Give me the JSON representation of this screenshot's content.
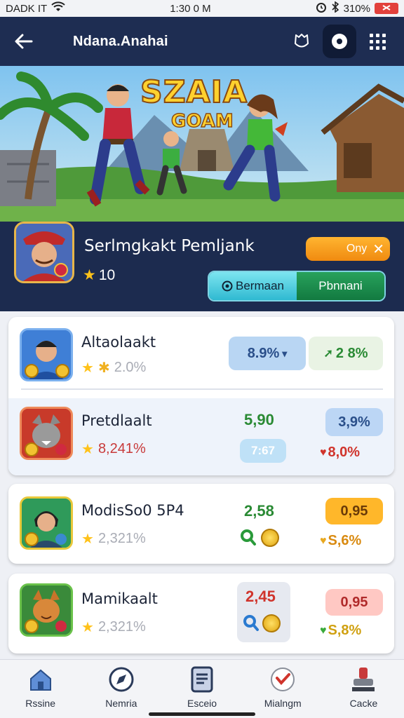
{
  "status_bar": {
    "carrier": "DADK IT",
    "time": "1:30 0 M",
    "battery": "310%"
  },
  "header": {
    "title": "Ndana.Anahai"
  },
  "banner": {
    "title": "SZAIA",
    "subtitle": "GOAM"
  },
  "profile": {
    "name": "Serlmgkakt Pemljank",
    "stars": "10",
    "only_button": "Ony",
    "seg_left": "Bermaan",
    "seg_right": "Pbnnani"
  },
  "rows": [
    {
      "name": "Altaolaakt",
      "stat": "2.0%",
      "box1": "8.9%",
      "box2": "2 8%",
      "box1_color": "#b9d6f3",
      "box2_color": "#e9f3e4"
    },
    {
      "name": "Pretdlaalt",
      "stat": "8,241%",
      "val1": "5,90",
      "chip": "7:67",
      "box2": "3,9%",
      "box2_color": "#bcd6f5",
      "stat2": "8,0%"
    },
    {
      "name": "ModisSo0 5P4",
      "stat": "2,321%",
      "val1": "2,58",
      "box2": "0,95",
      "box2_color": "#ffb72a",
      "stat2": "S,6%"
    },
    {
      "name": "Mamikaalt",
      "stat": "2,321%",
      "val1": "2,45",
      "box2": "0,95",
      "box2_color": "#ffc8c3",
      "stat2": "S,8%"
    }
  ],
  "nav": [
    {
      "label": "Rssine",
      "icon": "home-icon"
    },
    {
      "label": "Nemria",
      "icon": "compass-icon"
    },
    {
      "label": "Esceio",
      "icon": "tablet-icon"
    },
    {
      "label": "Mialngm",
      "icon": "heart-icon"
    },
    {
      "label": "Cacke",
      "icon": "stamp-icon"
    }
  ],
  "colors": {
    "header_bg": "#1e2d52",
    "accent_orange": "#f7a21d",
    "accent_green": "#1a8a4a",
    "accent_cyan": "#3cc3da"
  }
}
